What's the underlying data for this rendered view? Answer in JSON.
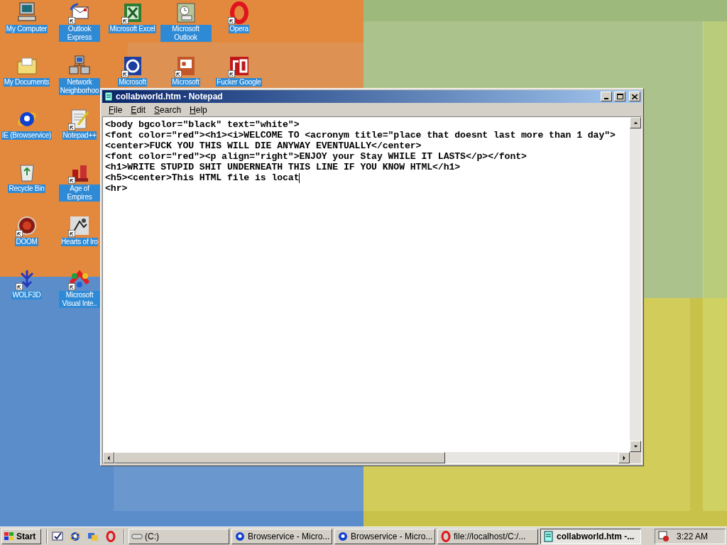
{
  "desktop_icon_rows": [
    [
      {
        "label": "My Computer",
        "shortcut": false
      },
      {
        "label": "Outlook Express",
        "shortcut": true
      },
      {
        "label": "Microsoft Excel",
        "shortcut": true
      },
      {
        "label": "Microsoft Outlook",
        "shortcut": false
      },
      {
        "label": "Opera",
        "shortcut": true
      }
    ],
    [
      {
        "label": "My Documents",
        "shortcut": false
      },
      {
        "label": "Network Neighborhoo",
        "shortcut": false
      },
      {
        "label": "Microsoft",
        "shortcut": true
      },
      {
        "label": "Microsoft",
        "shortcut": true
      },
      {
        "label": "Fucker Google",
        "shortcut": true
      }
    ],
    [
      {
        "label": "IE (Browservice)",
        "shortcut": false
      },
      {
        "label": "Notepad++",
        "shortcut": true
      }
    ],
    [
      {
        "label": "Recycle Bin",
        "shortcut": false
      },
      {
        "label": "Age of Empires",
        "shortcut": true
      }
    ],
    [
      {
        "label": "DOOM",
        "shortcut": true
      },
      {
        "label": "Hearts of Iro",
        "shortcut": true
      }
    ],
    [
      {
        "label": "WOLF3D",
        "shortcut": true
      },
      {
        "label": "Microsoft Visual Inte..",
        "shortcut": true
      }
    ]
  ],
  "notepad": {
    "title": "collabworld.htm - Notepad",
    "menu": [
      "File",
      "Edit",
      "Search",
      "Help"
    ],
    "lines": [
      {
        "text": "<body bgcolor=\"black\" text=\"white\">",
        "caret": false
      },
      {
        "text": "<font color=\"red\"><h1><i>WELCOME TO <acronym title=\"place that doesnt last more than 1 day\">",
        "caret": false
      },
      {
        "text": "<center>FUCK YOU THIS WILL DIE ANYWAY EVENTUALLY</center>",
        "caret": false
      },
      {
        "text": "<font color=\"red\"><p align=\"right\">ENJOY your Stay WHILE IT LASTS</p></font>",
        "caret": false
      },
      {
        "text": "<h1>WRITE STUPID SHIT UNDERNEATH THIS LINE IF YOU KNOW HTML</h1>",
        "caret": false
      },
      {
        "text": "<h5><center>This HTML file is locat",
        "caret": true
      },
      {
        "text": "<hr>",
        "caret": false
      }
    ]
  },
  "taskbar": {
    "start": "Start",
    "tasks": [
      {
        "label": "(C:)",
        "kind": "drive",
        "selected": false
      },
      {
        "label": "Browservice - Micro...",
        "kind": "browser",
        "selected": false
      },
      {
        "label": "Browservice - Micro...",
        "kind": "browser",
        "selected": false
      },
      {
        "label": "file://localhost/C:/...",
        "kind": "ring",
        "selected": false
      },
      {
        "label": "collabworld.htm -...",
        "kind": "notepad",
        "selected": true
      }
    ],
    "clock": "3:22 AM"
  }
}
